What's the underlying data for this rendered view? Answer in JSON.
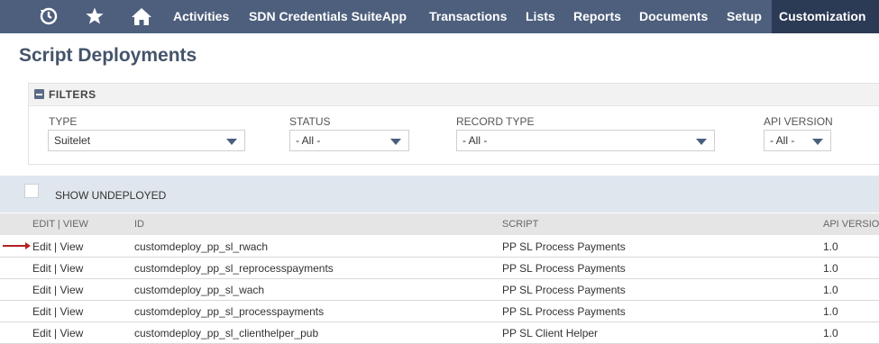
{
  "nav": {
    "menus": [
      "Activities",
      "SDN Credentials SuiteApp",
      "Transactions",
      "Lists",
      "Reports",
      "Documents",
      "Setup",
      "Customization"
    ],
    "active": "Customization"
  },
  "page_title": "Script Deployments",
  "filters": {
    "title": "FILTERS",
    "type": {
      "label": "TYPE",
      "value": "Suitelet"
    },
    "status": {
      "label": "STATUS",
      "value": "- All -"
    },
    "record_type": {
      "label": "RECORD TYPE",
      "value": "- All -"
    },
    "api_version": {
      "label": "API VERSION",
      "value": "- All -"
    }
  },
  "show_undeployed": {
    "label": "SHOW UNDEPLOYED",
    "checked": false
  },
  "table": {
    "headers": [
      "EDIT | VIEW",
      "ID",
      "SCRIPT",
      "API VERSIO"
    ],
    "rows": [
      {
        "edit": "Edit",
        "view": "View",
        "id": "customdeploy_pp_sl_rwach",
        "script": "PP SL Process Payments",
        "api": "1.0"
      },
      {
        "edit": "Edit",
        "view": "View",
        "id": "customdeploy_pp_sl_reprocesspayments",
        "script": "PP SL Process Payments",
        "api": "1.0"
      },
      {
        "edit": "Edit",
        "view": "View",
        "id": "customdeploy_pp_sl_wach",
        "script": "PP SL Process Payments",
        "api": "1.0"
      },
      {
        "edit": "Edit",
        "view": "View",
        "id": "customdeploy_pp_sl_processpayments",
        "script": "PP SL Process Payments",
        "api": "1.0"
      },
      {
        "edit": "Edit",
        "view": "View",
        "id": "customdeploy_pp_sl_clienthelper_pub",
        "script": "PP SL Client Helper",
        "api": "1.0"
      }
    ]
  },
  "colors": {
    "nav_bg": "#4d5f7c",
    "nav_active": "#2b3a55",
    "accent_arrow": "#b22222"
  }
}
